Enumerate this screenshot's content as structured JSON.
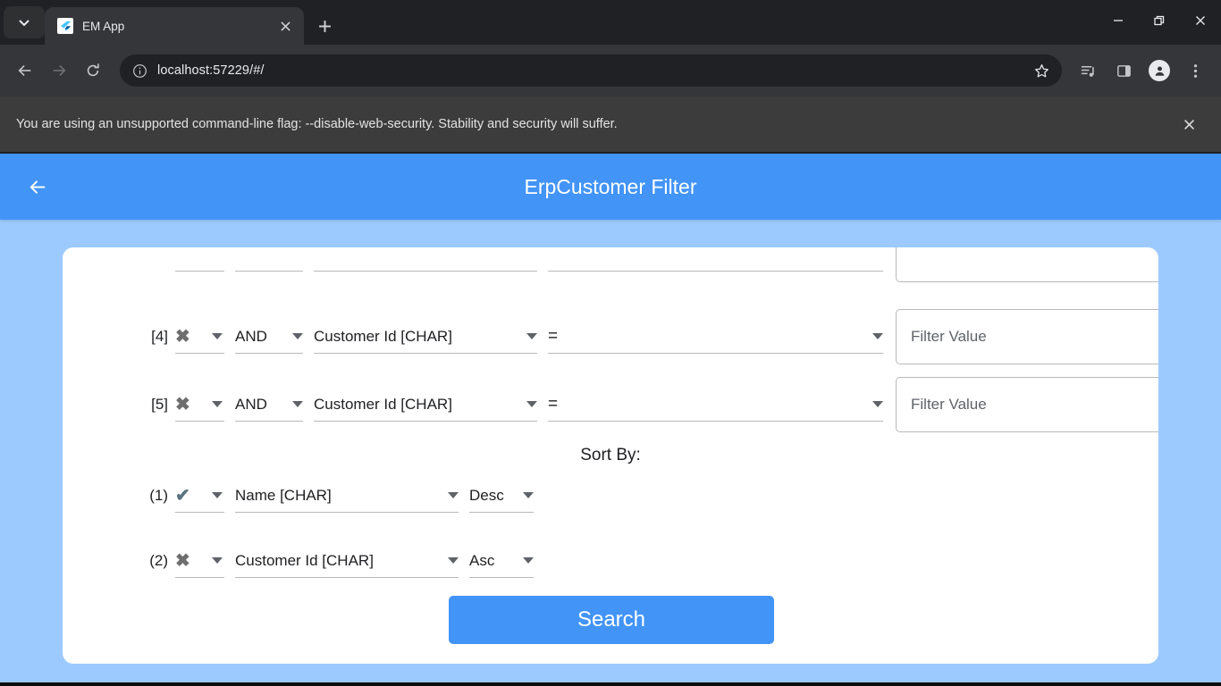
{
  "browser": {
    "tab": {
      "title": "EM App",
      "favicon": "flutter-logo"
    },
    "url": "localhost:57229/#/",
    "icons": {
      "tab_search": "chevron-down-icon",
      "new_tab": "plus-icon",
      "back": "back-arrow-icon",
      "forward": "forward-arrow-icon",
      "reload": "reload-icon",
      "site_info": "info-circle-icon",
      "bookmark": "star-icon",
      "reading_list": "playlist-icon",
      "side_panel": "side-panel-icon",
      "profile": "person-icon",
      "menu": "three-dots-icon",
      "minimize": "minimize-icon",
      "maximize": "restore-icon",
      "close": "close-icon"
    }
  },
  "infobar": {
    "message": "You are using an unsupported command-line flag: --disable-web-security. Stability and security will suffer.",
    "close_icon": "close-icon"
  },
  "app": {
    "title": "ErpCustomer Filter",
    "back_icon": "back-arrow-icon",
    "accent_color": "#4294f7",
    "background_color": "#9ccaff"
  },
  "filters": {
    "rows": [
      {
        "index": "[4]",
        "enabled": false,
        "state_mark": "✖",
        "logic": "AND",
        "field": "Customer Id [CHAR]",
        "operator": "=",
        "value": "",
        "value_placeholder": "Filter Value"
      },
      {
        "index": "[5]",
        "enabled": false,
        "state_mark": "✖",
        "logic": "AND",
        "field": "Customer Id [CHAR]",
        "operator": "=",
        "value": "",
        "value_placeholder": "Filter Value"
      }
    ]
  },
  "sort": {
    "label": "Sort By:",
    "rows": [
      {
        "index": "(1)",
        "enabled": true,
        "state_mark": "✔",
        "field": "Name [CHAR]",
        "direction": "Desc"
      },
      {
        "index": "(2)",
        "enabled": false,
        "state_mark": "✖",
        "field": "Customer Id [CHAR]",
        "direction": "Asc"
      }
    ]
  },
  "actions": {
    "search_label": "Search"
  }
}
